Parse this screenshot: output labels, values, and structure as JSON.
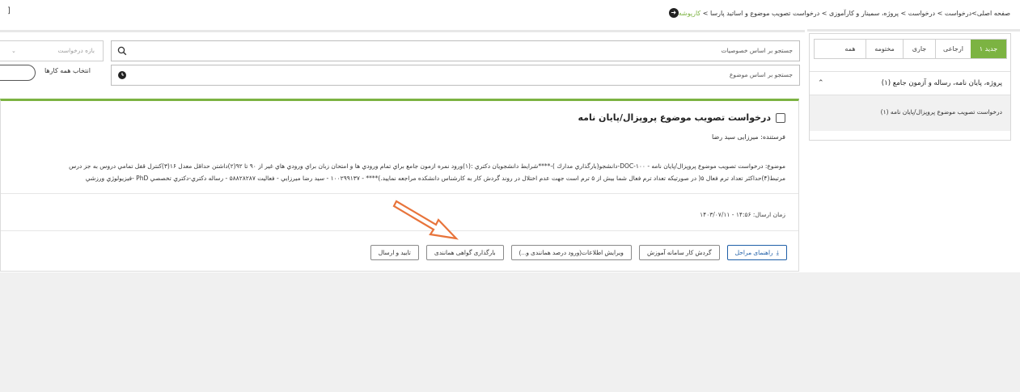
{
  "breadcrumb": {
    "path": "صفحه اصلی>درخواست > درخواست > پروژه، سمینار و کارآموزی > درخواست تصویب موضوع و اساتید پارسا > ",
    "current": "کارپوشه"
  },
  "corner_mark": "]",
  "sidebar": {
    "tabs": [
      {
        "label": "۱ جدید"
      },
      {
        "label": "ارجاعی"
      },
      {
        "label": "جاری"
      },
      {
        "label": "مختومه"
      },
      {
        "label": "همه"
      }
    ],
    "section_title": "پروژه، پایان نامه، رساله و آزمون جامع (۱)",
    "section_item": "درخواست تصویب موضوع پروپزال/پایان نامه (۱)"
  },
  "search": {
    "by_property_placeholder": "جستجو بر اساس خصوصیات",
    "by_subject_placeholder": "جستجو بر اساس موضوع",
    "date_range_placeholder": "بازه درخواست",
    "select_all_label": "انتخاب همه کارها"
  },
  "request": {
    "title": "درخواست تصویب موضوع پروپزال/پایان نامه",
    "sender": "فرستنده: میرزایی سید رضا",
    "subject_line1": "موضوع: درخواست تصویب موضوع پروپزال/پایان نامه - ۱۰۰-DOC-دانشجو(بارگذاري مدارك )-****شرايط دانشجويان دكتري :(۱)ورود نمره ازمون جامع براي تمام ورودي ها و امتحان زبان براي ورودي هاي غير از ۹۰ تا ۹۲(۲)داشتن حداقل معدل ۱۶(۳)کنترل قفل تمامي دروس به جز درس",
    "subject_line2": "مرتبط(۴)حداکثر تعداد ترم فعال ۵( در صورتيکه تعداد ترم فعال شما بيش از ۵ ترم است جهت عدم اختلال در روند گردش کار به کارشناس دانشکده مراجعه نماييد.)**** - ۱۰۰۲۹۹۱۳۷ - سيد رضا ميرزايي - فعاليت ۵۸۸۲۸۲۸۷ - رساله دکتري-دکتري تخصصي PhD -فيزيولوژي ورزشي",
    "sent_time": "زمان ارسال: ۱۴:۵۶ - ۱۴۰۳/۰۷/۱۱"
  },
  "actions": {
    "guide": "راهنمای مراحل",
    "workflow": "گردش کار سامانه آموزش",
    "edit_info": "ویرایش اطلاعات(ورود درصد همانندی و...)",
    "upload_certificate": "بارگذاری گواهی همانندی",
    "confirm_send": "تایید و ارسال"
  },
  "colors": {
    "accent_green": "#7cb342",
    "primary_blue": "#1f5fa8",
    "arrow_orange": "#e8743b"
  }
}
